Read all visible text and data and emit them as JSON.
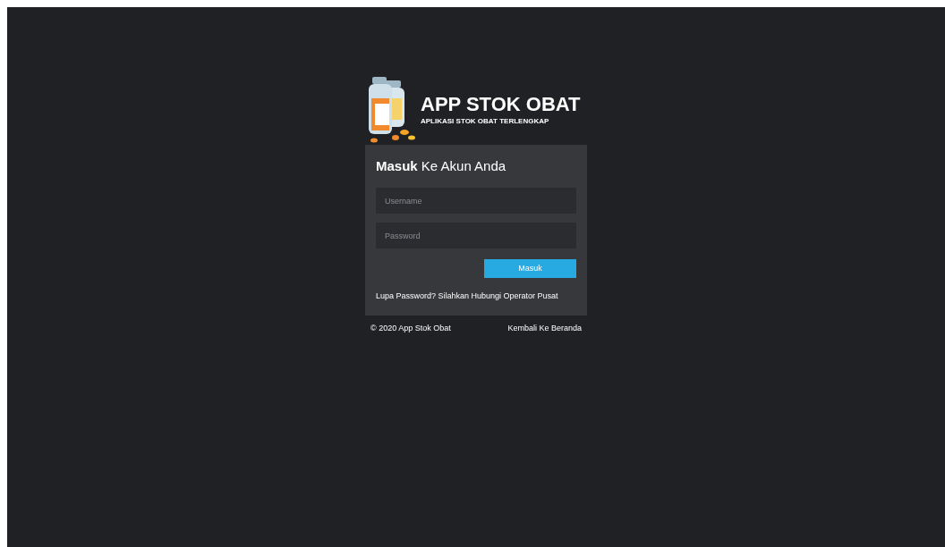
{
  "logo": {
    "title": "APP STOK OBAT",
    "subtitle": "APLIKASI STOK OBAT TERLENGKAP"
  },
  "login": {
    "heading": "**Masuk** Ke Akun Anda",
    "fields": [
      {
        "placeholder": "Username"
      },
      {
        "placeholder": "Password"
      }
    ],
    "button": "Masuk",
    "help": "Lupa Password? Silahkan Hubungi Operator Pusat"
  },
  "footer": {
    "copyright": "© 2020 App Stok Obat",
    "link": "Kembali Ke Beranda"
  }
}
